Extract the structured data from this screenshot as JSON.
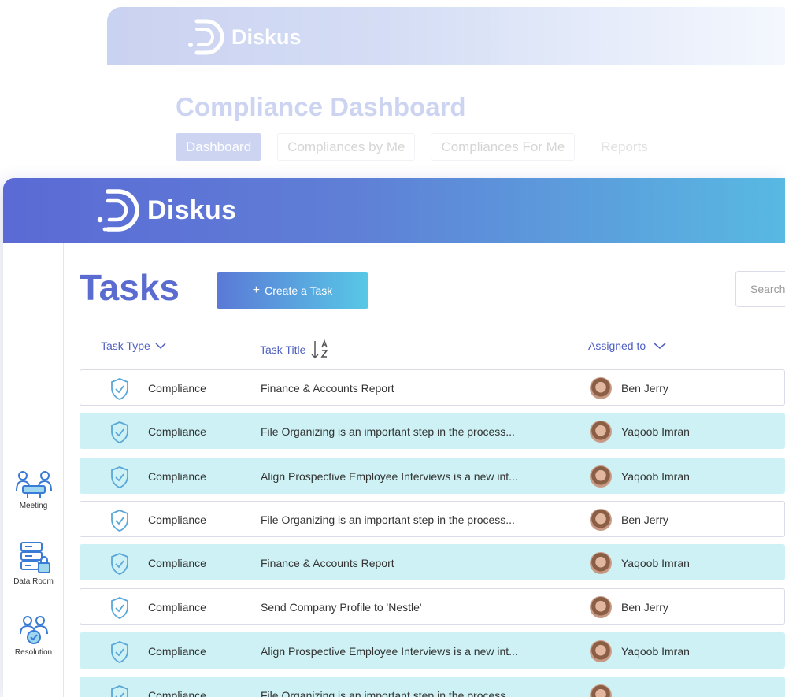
{
  "brand": {
    "name": "Diskus"
  },
  "background_window": {
    "title": "Compliance Dashboard",
    "tabs": [
      "Dashboard",
      "Compliances by Me",
      "Compliances For Me",
      "Reports"
    ],
    "active_tab": "Dashboard"
  },
  "sidebar": {
    "items": [
      {
        "label": "Meeting",
        "icon": "meeting-icon"
      },
      {
        "label": "Data Room",
        "icon": "data-room-icon"
      },
      {
        "label": "Resolution",
        "icon": "resolution-icon"
      }
    ]
  },
  "page": {
    "title": "Tasks",
    "create_button": "Create a Task",
    "search_placeholder": "Search"
  },
  "table": {
    "columns": [
      "Task Type",
      "Task Title",
      "Assigned to"
    ],
    "rows": [
      {
        "type": "Compliance",
        "title": "Finance & Accounts Report",
        "assignee": "Ben Jerry",
        "highlight": false
      },
      {
        "type": "Compliance",
        "title": "File Organizing is an important step in the process...",
        "assignee": "Yaqoob Imran",
        "highlight": true
      },
      {
        "type": "Compliance",
        "title": "Align Prospective Employee Interviews is a new int...",
        "assignee": "Yaqoob Imran",
        "highlight": true
      },
      {
        "type": "Compliance",
        "title": "File Organizing is an important step in the process...",
        "assignee": "Ben Jerry",
        "highlight": false
      },
      {
        "type": "Compliance",
        "title": "Finance & Accounts Report",
        "assignee": "Yaqoob Imran",
        "highlight": true
      },
      {
        "type": "Compliance",
        "title": "Send Company Profile to 'Nestle'",
        "assignee": "Ben Jerry",
        "highlight": false
      },
      {
        "type": "Compliance",
        "title": "Align Prospective Employee Interviews is a new int...",
        "assignee": "Yaqoob Imran",
        "highlight": true
      },
      {
        "type": "Compliance",
        "title": "File Organizing is an important step in the process...",
        "assignee": "",
        "highlight": true
      }
    ]
  },
  "colors": {
    "accent": "#5a6ccf",
    "row_highlight": "#cdf1f4",
    "header_start": "#5b6ad5",
    "header_end": "#58b9e2"
  }
}
